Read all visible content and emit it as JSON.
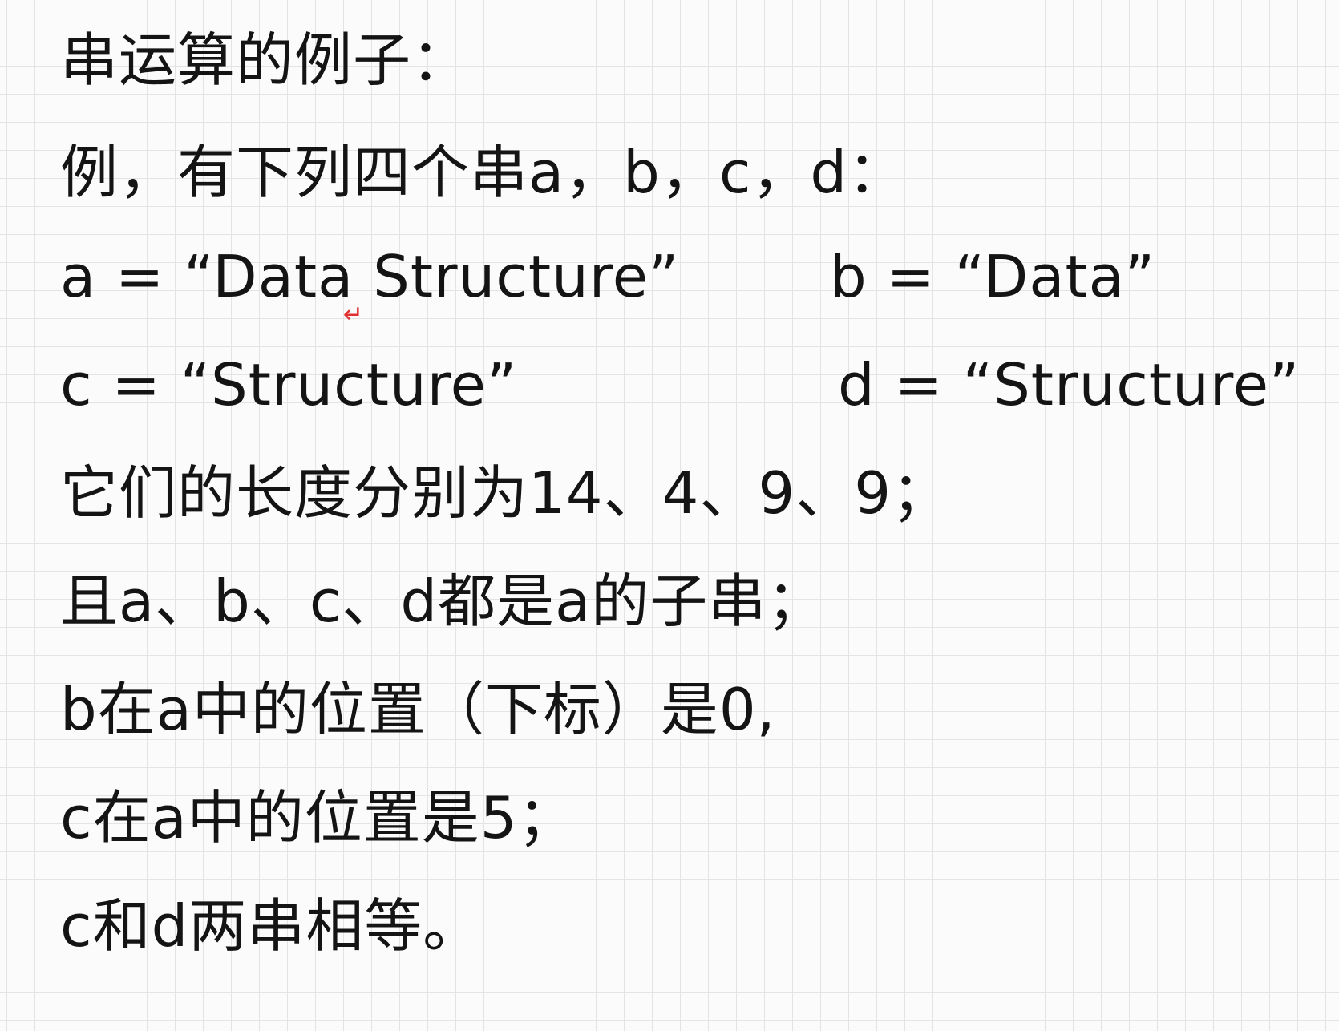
{
  "heading": "串运算的例子：",
  "intro": "例，有下列四个串a，b，c，d：",
  "definitions": {
    "a": "a = “Data Structure”",
    "b": "b = “Data”",
    "c": "c = “Structure”",
    "d": "d = “Structure”"
  },
  "space_mark": "↵",
  "lengths": "它们的长度分别为14、4、9、9；",
  "substrings": "且a、b、c、d都是a的子串；",
  "position_b": "b在a中的位置（下标）是0,",
  "position_c": "c在a中的位置是5；",
  "equality": "c和d两串相等。"
}
